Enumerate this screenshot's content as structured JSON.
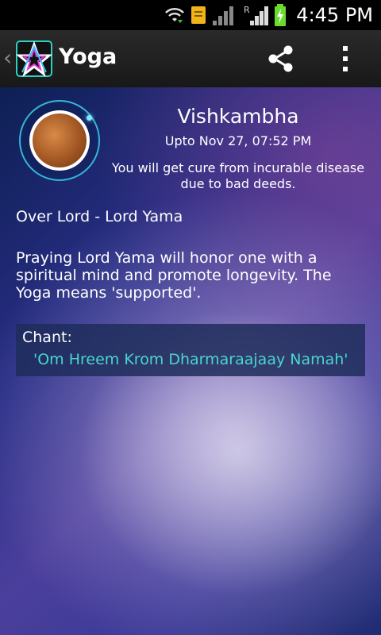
{
  "status_bar": {
    "time": "4:45 PM",
    "icons": [
      "wifi-icon",
      "download-icon",
      "notification-icon",
      "signal-icon",
      "roaming-signal-icon",
      "battery-charging-icon"
    ],
    "roaming_label": "R"
  },
  "app_bar": {
    "title": "Yoga",
    "actions": [
      "share-icon",
      "more-vert-icon"
    ]
  },
  "yoga": {
    "name": "Vishkambha",
    "upto": "Upto Nov  27, 07:52 PM",
    "effect": "You will get cure from incurable disease due to bad deeds.",
    "overlord": "Over Lord - Lord Yama",
    "description": "Praying Lord Yama will honor one with a spiritual mind and promote longevity. The Yoga means 'supported'.",
    "chant_label": "Chant:",
    "chant_text": "'Om Hreem Krom Dharmaraajaay Namah'"
  },
  "colors": {
    "chant_text": "#49d6cf",
    "ring": "#34b7d6",
    "app_bar": "#1e1e1e"
  }
}
